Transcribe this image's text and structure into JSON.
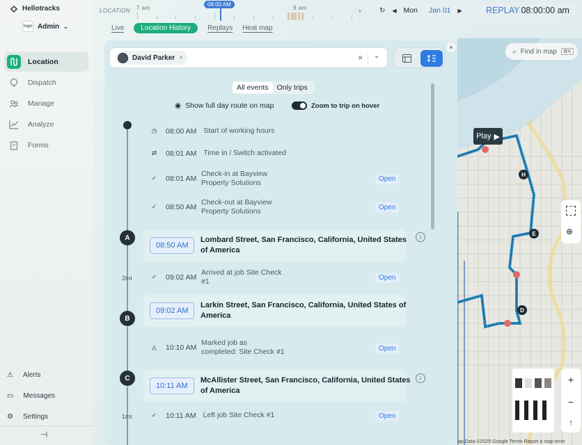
{
  "brand": {
    "name": "Hellotracks"
  },
  "user": {
    "name": "Admin",
    "logo_text": "logo"
  },
  "nav": [
    {
      "label": "Location",
      "icon": "location-route-icon",
      "active": true
    },
    {
      "label": "Dispatch",
      "icon": "dispatch-icon",
      "active": false
    },
    {
      "label": "Manage",
      "icon": "manage-users-icon",
      "active": false
    },
    {
      "label": "Analyze",
      "icon": "analyze-chart-icon",
      "active": false
    },
    {
      "label": "Forms",
      "icon": "forms-icon",
      "active": false
    }
  ],
  "bottom_nav": [
    {
      "label": "Alerts",
      "icon": "alert-icon"
    },
    {
      "label": "Messages",
      "icon": "messages-icon"
    },
    {
      "label": "Settings",
      "icon": "settings-gear-icon"
    }
  ],
  "timeline": {
    "label": "LOCATION",
    "hour1": "7 am",
    "hour2": "9 am",
    "current": "08:00 AM"
  },
  "tabs": [
    {
      "label": "Live",
      "active": false
    },
    {
      "label": "Location History",
      "active": true
    },
    {
      "label": "Replays",
      "active": false
    },
    {
      "label": "Heat map",
      "active": false
    }
  ],
  "date": {
    "day": "Mon",
    "date": "Jan 01"
  },
  "replay": {
    "label": "REPLAY",
    "time": "08:00:00 am"
  },
  "search": {
    "chip": "David Parker"
  },
  "segment": {
    "all": "All events",
    "trips": "Only trips"
  },
  "options": {
    "full_route": "Show full day route on map",
    "zoom": "Zoom to trip on hover"
  },
  "events_top": [
    {
      "time": "08:00 AM",
      "text1": "Start of working hours",
      "text2": "",
      "open": ""
    },
    {
      "time": "08:01 AM",
      "text1": "Time in / Switch activated",
      "text2": "",
      "open": ""
    },
    {
      "time": "08:01 AM",
      "text1": "Check-in at Bayview",
      "text2": "Property Solutions",
      "open": "Open"
    },
    {
      "time": "08:50 AM",
      "text1": "Check-out at Bayview",
      "text2": "Property Solutions",
      "open": "Open"
    }
  ],
  "stops": [
    {
      "letter": "A",
      "time": "08:50 AM",
      "addr1": "Lombard Street, San Francisco, California, United States",
      "addr2": "of America"
    },
    {
      "letter": "B",
      "time": "09:02 AM",
      "addr1": "Larkin Street, San Francisco, California, United States of",
      "addr2": "America"
    },
    {
      "letter": "C",
      "time": "10:11 AM",
      "addr1": "McAllister Street, San Francisco, California, United States",
      "addr2": "of America"
    }
  ],
  "distances": [
    "2mi",
    "1mi"
  ],
  "events_mid": [
    {
      "time": "09:02 AM",
      "text1": "Arrived at job Site Check",
      "text2": "#1",
      "open": "Open"
    },
    {
      "time": "10:10 AM",
      "text1": "Marked job as",
      "text2": "completed: Site Check #1",
      "open": "Open"
    },
    {
      "time": "10:11 AM",
      "text1": "Left job Site Check #1",
      "text2": "",
      "open": "Open"
    }
  ],
  "map": {
    "find": "Find in map",
    "shortcut": "⌘K",
    "play": "Play",
    "markers": [
      "H",
      "E",
      "D"
    ],
    "attribution": "ap Data ©2025 Google   Terms   Report a map error"
  }
}
